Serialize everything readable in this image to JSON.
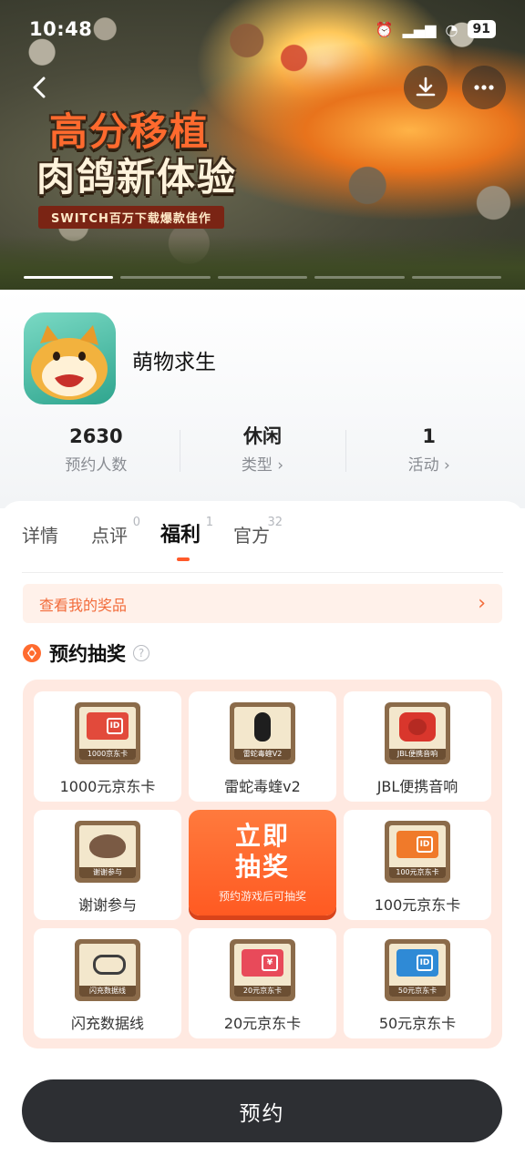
{
  "status_bar": {
    "time": "10:48",
    "battery": "91",
    "icons": [
      "alarm-icon",
      "mute-icon",
      "signal-icon",
      "signal-icon",
      "wifi-icon"
    ]
  },
  "banner": {
    "title_line1": "高分移植",
    "title_line2": "肉鸽新体验",
    "subtitle": "SWITCH百万下载爆款佳作",
    "page_count": 5,
    "active_page": 1
  },
  "app": {
    "name": "萌物求生"
  },
  "stats": [
    {
      "value": "2630",
      "label": "预约人数"
    },
    {
      "value": "休闲",
      "label": "类型 ›"
    },
    {
      "value": "1",
      "label": "活动 ›"
    }
  ],
  "tabs": [
    {
      "label": "详情",
      "count": ""
    },
    {
      "label": "点评",
      "count": "0"
    },
    {
      "label": "福利",
      "count": "1"
    },
    {
      "label": "官方",
      "count": "32"
    }
  ],
  "prize_link": {
    "label": "查看我的奖品",
    "arrow": "›"
  },
  "section": {
    "title": "预约抽奖",
    "help": "?"
  },
  "lottery": {
    "prizes": [
      {
        "label": "1000元京东卡",
        "tag": "1000京东卡",
        "color": "#e24a3b"
      },
      {
        "label": "雷蛇毒蝰v2",
        "tag": "雷蛇毒蝰V2",
        "color": "#1e1e1e"
      },
      {
        "label": "JBL便携音响",
        "tag": "JBL便携音响",
        "color": "#d9362c"
      },
      {
        "label": "谢谢参与",
        "tag": "谢谢参与",
        "color": "#7a5a44"
      },
      {
        "label": "100元京东卡",
        "tag": "100元京东卡",
        "color": "#f07a2a"
      },
      {
        "label": "闪充数据线",
        "tag": "闪充数据线",
        "color": "#3e3e3e"
      },
      {
        "label": "20元京东卡",
        "tag": "20元京东卡",
        "color": "#e84a5a"
      },
      {
        "label": "50元京东卡",
        "tag": "50元京东卡",
        "color": "#2f8ad6"
      }
    ],
    "draw_button": {
      "line1": "立即",
      "line2": "抽奖",
      "note": "预约游戏后可抽奖"
    }
  },
  "reserve_button": {
    "label": "预约"
  }
}
